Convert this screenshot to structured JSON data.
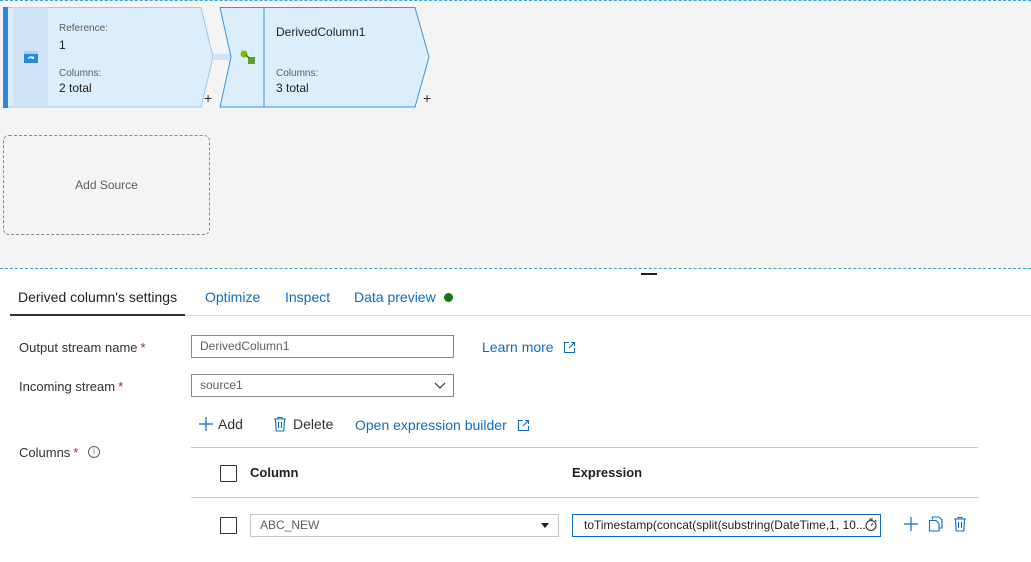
{
  "canvas": {
    "node_source": {
      "reference_label": "Reference:",
      "reference_value": "1",
      "columns_label": "Columns:",
      "columns_value": "2 total",
      "plus": "+"
    },
    "node_derived": {
      "title": "DerivedColumn1",
      "columns_label": "Columns:",
      "columns_value": "3 total",
      "plus": "+"
    },
    "add_source": "Add Source"
  },
  "tabs": [
    {
      "label": "Derived column's settings",
      "active": true
    },
    {
      "label": "Optimize"
    },
    {
      "label": "Inspect"
    },
    {
      "label": "Data preview"
    }
  ],
  "form": {
    "output_stream": {
      "label": "Output stream name",
      "required": "*",
      "value": "DerivedColumn1"
    },
    "learn_more": "Learn more",
    "incoming_stream": {
      "label": "Incoming stream",
      "required": "*",
      "value": "source1"
    },
    "columns": {
      "label": "Columns",
      "required": "*",
      "info": "i"
    }
  },
  "toolbar": {
    "add": "Add",
    "delete": "Delete",
    "open_builder": "Open expression builder"
  },
  "table": {
    "col_column": "Column",
    "col_expression": "Expression",
    "rows": [
      {
        "column": "ABC_NEW",
        "expression": "toTimestamp(concat(split(substring(DateTime,1, 10..."
      }
    ]
  },
  "colors": {
    "accent": "#0f6cbd",
    "node_fill": "#dcedfc",
    "node_border": "#3a96dd",
    "status_ok": "#107c10",
    "required": "#a4262c"
  }
}
